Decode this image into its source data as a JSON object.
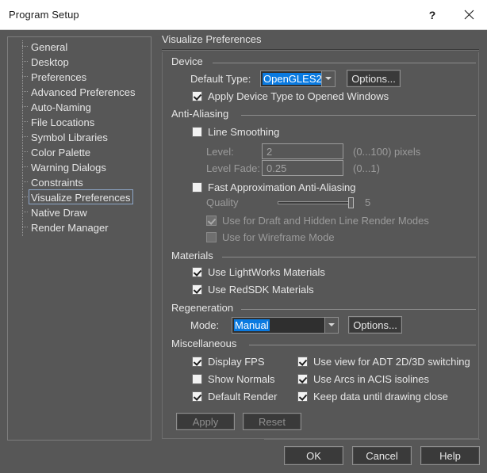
{
  "titlebar": {
    "title": "Program Setup",
    "help_label": "?",
    "close_label": "✕"
  },
  "sidebar": {
    "items": [
      {
        "label": "General",
        "selected": false
      },
      {
        "label": "Desktop",
        "selected": false
      },
      {
        "label": "Preferences",
        "selected": false
      },
      {
        "label": "Advanced Preferences",
        "selected": false
      },
      {
        "label": "Auto-Naming",
        "selected": false
      },
      {
        "label": "File Locations",
        "selected": false
      },
      {
        "label": "Symbol Libraries",
        "selected": false
      },
      {
        "label": "Color Palette",
        "selected": false
      },
      {
        "label": "Warning Dialogs",
        "selected": false
      },
      {
        "label": "Constraints",
        "selected": false
      },
      {
        "label": "Visualize Preferences",
        "selected": true
      },
      {
        "label": "Native Draw",
        "selected": false
      },
      {
        "label": "Render Manager",
        "selected": false
      }
    ]
  },
  "content": {
    "title": "Visualize Preferences",
    "device": {
      "group_title": "Device",
      "default_type_label": "Default Type:",
      "default_type_value": "OpenGLES2",
      "options_label": "Options...",
      "apply_device_label": "Apply Device Type to Opened Windows"
    },
    "anti_aliasing": {
      "group_title": "Anti-Aliasing",
      "line_smoothing_label": "Line Smoothing",
      "level_label": "Level:",
      "level_value": "2",
      "level_hint": "(0...100) pixels",
      "level_fade_label": "Level Fade:",
      "level_fade_value": "0.25",
      "level_fade_hint": "(0...1)",
      "faa_label": "Fast Approximation Anti-Aliasing",
      "quality_label": "Quality",
      "quality_value": "5",
      "draft_hidden_label": "Use for Draft and Hidden Line Render Modes",
      "wireframe_label": "Use for Wireframe Mode"
    },
    "materials": {
      "group_title": "Materials",
      "lightworks_label": "Use LightWorks Materials",
      "redsdk_label": "Use RedSDK Materials"
    },
    "regeneration": {
      "group_title": "Regeneration",
      "mode_label": "Mode:",
      "mode_value": "Manual",
      "options_label": "Options..."
    },
    "miscellaneous": {
      "group_title": "Miscellaneous",
      "display_fps_label": "Display FPS",
      "show_normals_label": "Show Normals",
      "default_render_label": "Default Render",
      "adt_switching_label": "Use view for ADT 2D/3D switching",
      "acis_isolines_label": "Use Arcs in ACIS isolines",
      "keep_data_label": "Keep data until drawing close",
      "apply_label": "Apply",
      "reset_label": "Reset"
    }
  },
  "footer": {
    "ok_label": "OK",
    "cancel_label": "Cancel",
    "help_label": "Help"
  },
  "colors": {
    "dialog_bg": "#575757",
    "titlebar_bg": "#ffffff",
    "selection_blue": "#0a7ae0",
    "text": "#e6e6e6",
    "disabled_text": "#9b9b9b"
  }
}
